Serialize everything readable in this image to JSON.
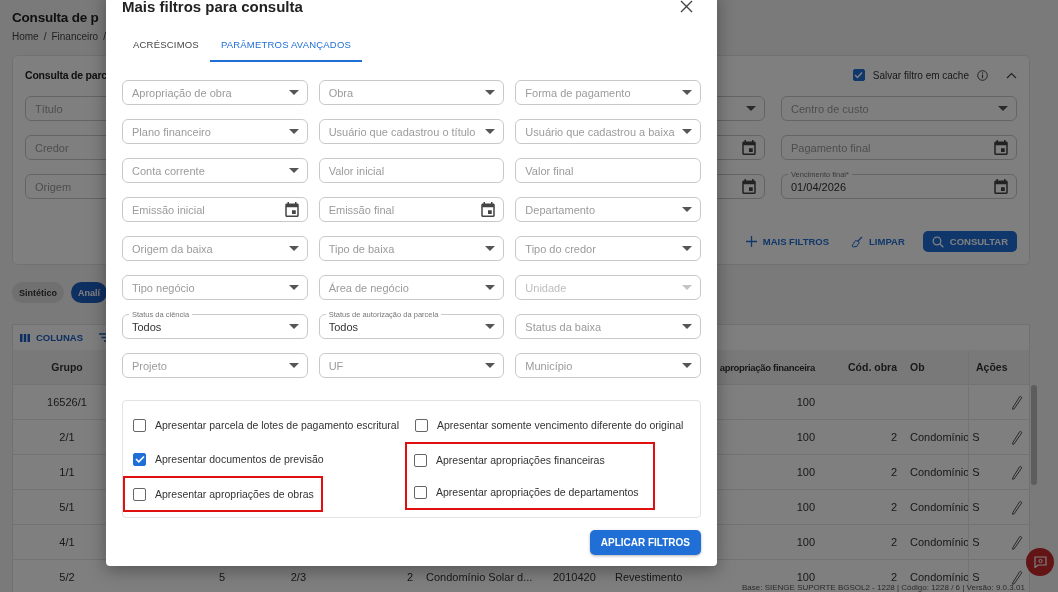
{
  "page": {
    "title": "Consulta de p",
    "breadcrumb": [
      "Home",
      "/",
      "Financeiro",
      "/"
    ]
  },
  "filter_card": {
    "title": "Consulta de parc",
    "save_cache": {
      "label": "Salvar filtro em cache",
      "checked": true
    },
    "left_fields": [
      {
        "kind": "text",
        "placeholder": "Título"
      },
      {
        "kind": "text",
        "placeholder": "Credor"
      },
      {
        "kind": "text",
        "placeholder": "Origem"
      }
    ],
    "right_fields": [
      {
        "kind": "select"
      },
      {
        "kind": "select",
        "placeholder": "Centro de custo"
      },
      {
        "kind": "date"
      },
      {
        "kind": "date",
        "placeholder": "Pagamento final"
      },
      {
        "kind": "date"
      },
      {
        "kind": "date",
        "label": "Vencimento final*",
        "value": "01/04/2026"
      }
    ],
    "actions": [
      {
        "kind": "more",
        "label": "MAIS FILTROS"
      },
      {
        "kind": "clear",
        "label": "LIMPAR"
      },
      {
        "kind": "search",
        "label": "CONSULTAR"
      }
    ]
  },
  "view_toggle": [
    {
      "label": "Sintético",
      "selected": false
    },
    {
      "label": "Analí",
      "selected": true
    }
  ],
  "table": {
    "toolbar_label": "COLUNAS",
    "columns": [
      {
        "label": "Grupo"
      },
      {
        "label": "apropriação financeira"
      },
      {
        "label": "Cód. obra"
      },
      {
        "label": "Ob"
      },
      {
        "label": "Ações"
      }
    ],
    "rows": [
      {
        "grupo": "16526/1",
        "apropriacao_financeira": "100"
      },
      {
        "grupo": "2/1",
        "apropriacao_financeira": "100",
        "cod_obra": "2",
        "obra": "Condomínio S"
      },
      {
        "grupo": "1/1",
        "apropriacao_financeira": "100",
        "cod_obra": "2",
        "obra": "Condomínio S"
      },
      {
        "grupo": "5/1",
        "apropriacao_financeira": "100",
        "cod_obra": "2",
        "obra": "Condomínio S"
      },
      {
        "grupo": "4/1",
        "apropriacao_financeira": "100",
        "cod_obra": "2",
        "obra": "Condomínio S"
      },
      {
        "grupo": "5/2",
        "column_2": "5",
        "column_3": "2/3",
        "column_4": "2",
        "column_5": "Condomínio Solar d...",
        "column_6": "2010420",
        "column_7": "Revestimento",
        "apropriacao_financeira": "100",
        "cod_obra": "2",
        "obra": "Condomínio S"
      }
    ]
  },
  "footer": "Base: SIENGE SUPORTE BGSOL2 - 1228 | Código: 1228 / 6 | Versão: 9.0.3.01",
  "dialog": {
    "title": "Mais filtros para consulta",
    "tabs": [
      {
        "label": "ACRÉSCIMOS",
        "selected": false
      },
      {
        "label": "PARÂMETROS AVANÇADOS",
        "selected": true
      }
    ],
    "fields": [
      {
        "kind": "select",
        "placeholder": "Apropriação de obra",
        "disabled": false
      },
      {
        "kind": "select",
        "placeholder": "Obra",
        "disabled": false
      },
      {
        "kind": "select",
        "placeholder": "Forma de pagamento",
        "disabled": false
      },
      {
        "kind": "select",
        "placeholder": "Plano financeiro",
        "disabled": false
      },
      {
        "kind": "select",
        "placeholder": "Usuário que cadastrou o título",
        "disabled": false
      },
      {
        "kind": "select",
        "placeholder": "Usuário que cadastrou a baixa",
        "disabled": false
      },
      {
        "kind": "select",
        "placeholder": "Conta corrente",
        "disabled": false
      },
      {
        "kind": "text",
        "placeholder": "Valor inicial",
        "disabled": false
      },
      {
        "kind": "text",
        "placeholder": "Valor final",
        "disabled": false
      },
      {
        "kind": "date",
        "placeholder": "Emissão inicial",
        "disabled": false
      },
      {
        "kind": "date",
        "placeholder": "Emissão final",
        "disabled": false
      },
      {
        "kind": "select",
        "placeholder": "Departamento",
        "disabled": false
      },
      {
        "kind": "select",
        "placeholder": "Origem da baixa",
        "disabled": false
      },
      {
        "kind": "select",
        "placeholder": "Tipo de baixa",
        "disabled": false
      },
      {
        "kind": "select",
        "placeholder": "Tipo do credor",
        "disabled": false
      },
      {
        "kind": "select",
        "placeholder": "Tipo negócio",
        "disabled": false
      },
      {
        "kind": "select",
        "placeholder": "Área de negócio",
        "disabled": false
      },
      {
        "kind": "select",
        "placeholder": "Unidade",
        "disabled": true
      },
      {
        "kind": "select",
        "label": "Status da ciência",
        "value": "Todos",
        "disabled": false
      },
      {
        "kind": "select",
        "label": "Status de autorização da parcela",
        "value": "Todos",
        "disabled": false
      },
      {
        "kind": "select",
        "placeholder": "Status da baixa",
        "disabled": false
      },
      {
        "kind": "select",
        "placeholder": "Projeto",
        "disabled": false
      },
      {
        "kind": "select",
        "placeholder": "UF",
        "disabled": false
      },
      {
        "kind": "select",
        "placeholder": "Município",
        "disabled": false
      }
    ],
    "options": {
      "columns": [
        {
          "blocks": [
            {
              "highlighted": false,
              "items": [
                {
                  "label": "Apresentar parcela de lotes de pagamento escritural",
                  "checked": false
                },
                {
                  "label": "Apresentar documentos de previsão",
                  "checked": true
                }
              ]
            },
            {
              "highlighted": true,
              "items": [
                {
                  "label": "Apresentar apropriações de obras",
                  "checked": false
                }
              ]
            }
          ]
        },
        {
          "blocks": [
            {
              "highlighted": false,
              "items": [
                {
                  "label": "Apresentar somente vencimento diferente do original",
                  "checked": false
                }
              ]
            },
            {
              "highlighted": true,
              "items": [
                {
                  "label": "Apresentar apropriações financeiras",
                  "checked": false
                },
                {
                  "label": "Apresentar apropriações de departamentos",
                  "checked": false
                }
              ]
            }
          ]
        }
      ]
    },
    "apply_button": "APLICAR FILTROS"
  }
}
